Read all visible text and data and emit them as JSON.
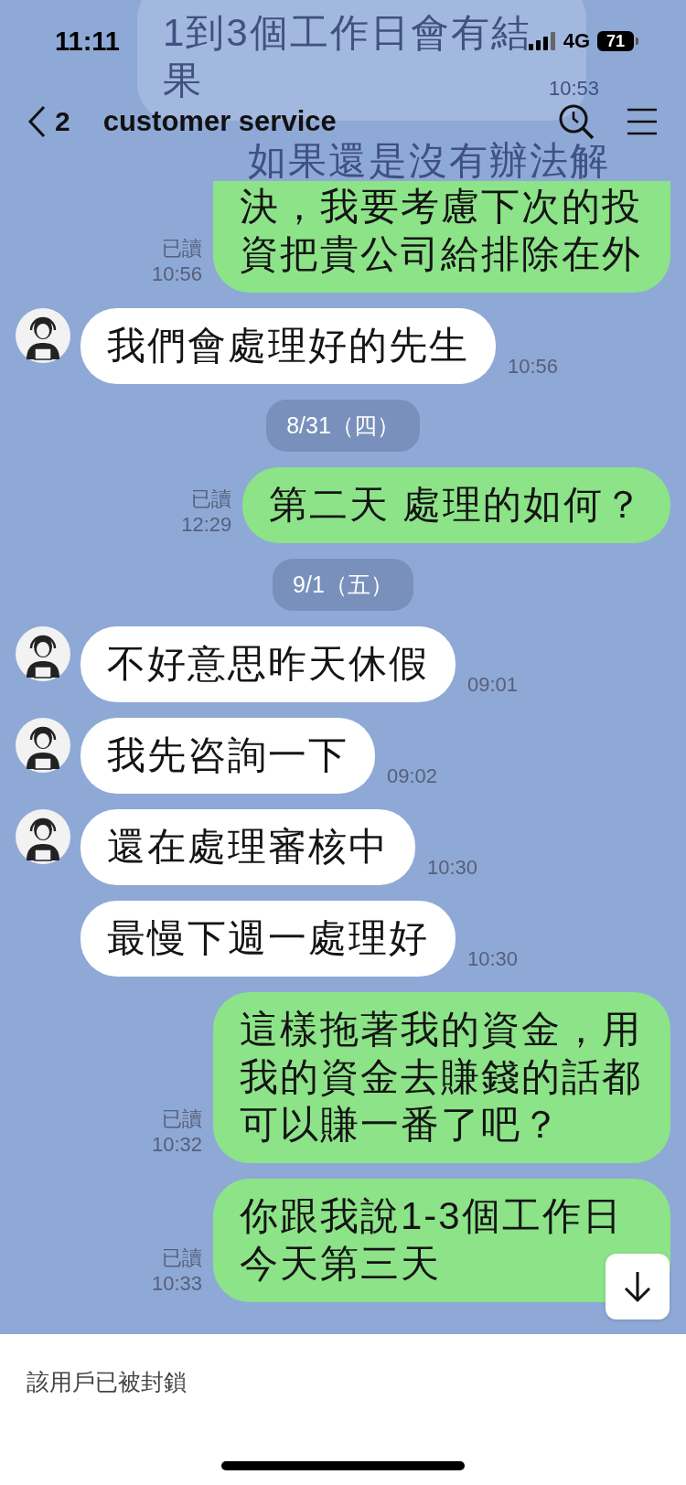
{
  "status_bar": {
    "time": "11:11",
    "network": "4G",
    "battery": "71"
  },
  "behind_header": {
    "message": "1到3個工作日會有結果",
    "time": "10:53",
    "next_line": "如果還是沒有辦法解"
  },
  "header": {
    "back_count": "2",
    "title": "customer service"
  },
  "messages": [
    {
      "kind": "outgoing",
      "text": "決，我要考慮下次的投資把貴公司給排除在外",
      "read": "已讀",
      "time": "10:56",
      "cut_top": true
    },
    {
      "kind": "incoming",
      "text": "我們會處理好的先生",
      "time": "10:56",
      "show_avatar": true
    },
    {
      "kind": "date",
      "text": "8/31（四）"
    },
    {
      "kind": "outgoing",
      "text": "第二天 處理的如何？",
      "read": "已讀",
      "time": "12:29",
      "cut_top": false
    },
    {
      "kind": "date",
      "text": "9/1（五）"
    },
    {
      "kind": "incoming",
      "text": "不好意思昨天休假",
      "time": "09:01",
      "show_avatar": true
    },
    {
      "kind": "incoming",
      "text": "我先咨詢一下",
      "time": "09:02",
      "show_avatar": true
    },
    {
      "kind": "incoming",
      "text": "還在處理審核中",
      "time": "10:30",
      "show_avatar": true
    },
    {
      "kind": "incoming",
      "text": "最慢下週一處理好",
      "time": "10:30",
      "show_avatar": false
    },
    {
      "kind": "outgoing",
      "text": "這樣拖著我的資金，用我的資金去賺錢的話都可以賺一番了吧？",
      "read": "已讀",
      "time": "10:32",
      "cut_top": false
    },
    {
      "kind": "outgoing",
      "text": "你跟我說1-3個工作日今天第三天",
      "read": "已讀",
      "time": "10:33",
      "cut_top": false
    }
  ],
  "footer": {
    "notice": "該用戶已被封鎖"
  }
}
